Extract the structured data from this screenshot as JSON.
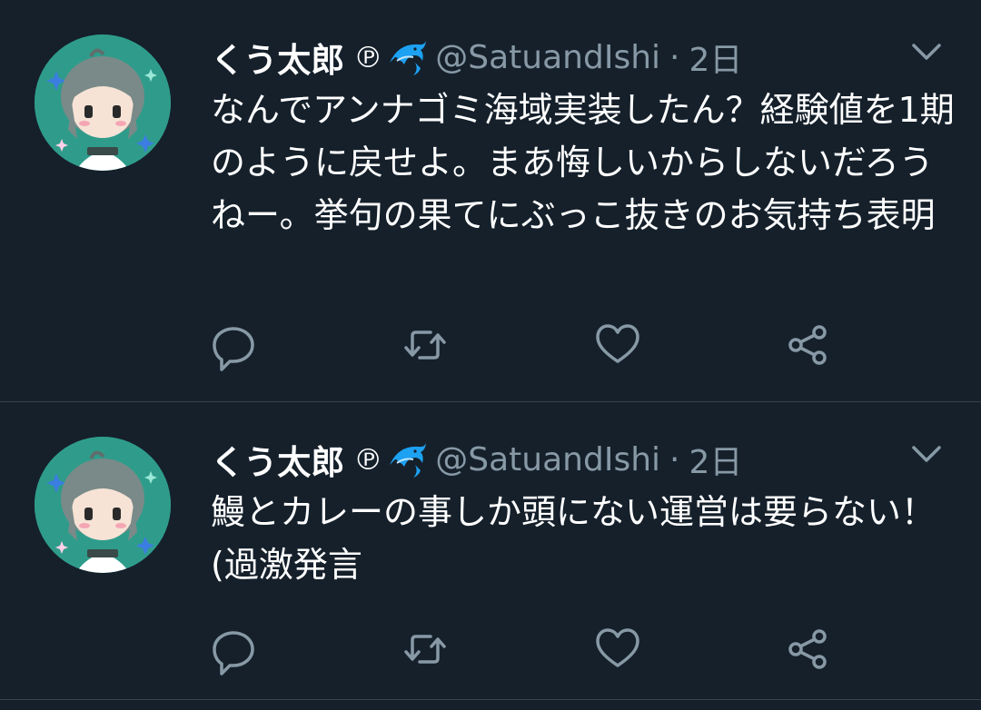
{
  "colors": {
    "background": "#15202b",
    "divider": "#38444d",
    "text_primary": "#ffffff",
    "text_secondary": "#8899a6",
    "avatar_bg": "#2f9c8b",
    "dolphin": "#1da1f2"
  },
  "tweets": [
    {
      "display_name": "くう太郎",
      "badge": "℗",
      "name_emoji": "dolphin-icon",
      "handle": "@SatuandIshi",
      "separator": "·",
      "time": "2日",
      "text": "なんでアンナゴミ海域実装したん？経験値を1期のように戻せよ。まあ悔しいからしないだろうねー。挙句の果てにぶっこ抜きのお気持ち表明",
      "avatar_label": "CQH/HGE",
      "actions": [
        "reply-icon",
        "retweet-icon",
        "like-icon",
        "share-icon"
      ]
    },
    {
      "display_name": "くう太郎",
      "badge": "℗",
      "name_emoji": "dolphin-icon",
      "handle": "@SatuandIshi",
      "separator": "·",
      "time": "2日",
      "text": "鰻とカレーの事しか頭にない運営は要らない！(過激発言",
      "avatar_label": "CQH/HGE",
      "actions": [
        "reply-icon",
        "retweet-icon",
        "like-icon",
        "share-icon"
      ]
    }
  ]
}
